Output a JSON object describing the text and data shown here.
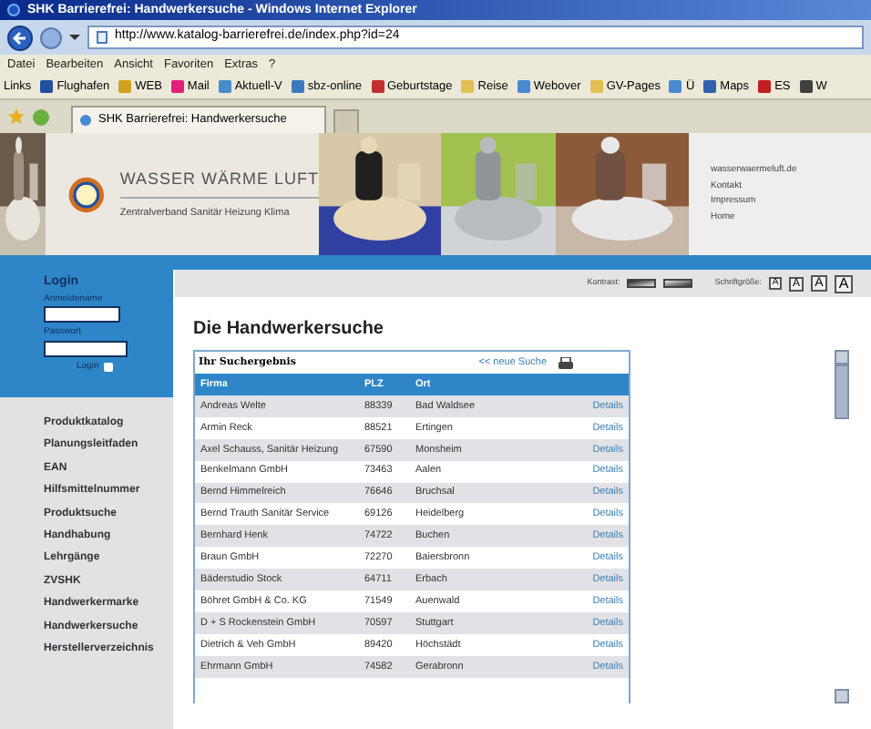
{
  "window": {
    "title": "SHK Barrierefrei: Handwerkersuche - Windows Internet Explorer"
  },
  "address_bar": {
    "value": "http://www.katalog-barrierefrei.de/index.php?id=24"
  },
  "menu": [
    "Datei",
    "Bearbeiten",
    "Ansicht",
    "Favoriten",
    "Extras",
    "?"
  ],
  "links_bar": {
    "label": "Links",
    "items": [
      {
        "label": "Flughafen",
        "color": "#2050a0"
      },
      {
        "label": "WEB",
        "color": "#d0a020"
      },
      {
        "label": "Mail",
        "color": "#e0207a"
      },
      {
        "label": "Aktuell-V",
        "color": "#4a8ad0"
      },
      {
        "label": "sbz-online",
        "color": "#3a7ac0"
      },
      {
        "label": "Geburtstage",
        "color": "#c03030"
      },
      {
        "label": "Reise",
        "color": "#e0c050"
      },
      {
        "label": "Webover",
        "color": "#4a8ad0"
      },
      {
        "label": "GV-Pages",
        "color": "#e0c050"
      },
      {
        "label": "Ü",
        "color": "#4a8ad0"
      },
      {
        "label": "Maps",
        "color": "#3060b0"
      },
      {
        "label": "ES",
        "color": "#c02020"
      },
      {
        "label": "W",
        "color": "#404040"
      }
    ]
  },
  "tabs": [
    {
      "label": "SHK Barrierefrei: Handwerkersuche",
      "selected": true
    }
  ],
  "banner": {
    "logo_title": "WASSER WÄRME LUFT",
    "logo_subtitle": "Zentralverband Sanitär Heizung Klima",
    "links": [
      "wasserwaermeluft.de",
      "Kontakt",
      "Impressum",
      "Home"
    ]
  },
  "login": {
    "title": "Login",
    "username_label": "Anmeldename",
    "password_label": "Passwort",
    "button": "Login"
  },
  "nav": [
    "Produktkatalog",
    "Planungsleitfaden",
    "EAN",
    "Hilfsmittelnummer",
    "Produktsuche",
    "Handhabung",
    "Lehrgänge",
    "ZVSHK",
    "Handwerkermarke",
    "Handwerkersuche",
    "Herstellerverzeichnis"
  ],
  "toolbar": {
    "contrast_label": "Kontrast:",
    "font_size_label": "Schriftgröße:",
    "font_sizes": [
      "A",
      "A",
      "A",
      "A"
    ]
  },
  "page_title": "Die Handwerkersuche",
  "results": {
    "title": "Ihr Suchergebnis",
    "new_search": "<< neue Suche",
    "columns": [
      "Firma",
      "PLZ",
      "Ort"
    ],
    "rows": [
      [
        "Andreas Welte",
        "88339",
        "Bad Waldsee",
        "Details"
      ],
      [
        "Armin Reck",
        "88521",
        "Ertingen",
        "Details"
      ],
      [
        "Axel Schauss, Sanitär Heizung",
        "67590",
        "Monsheim",
        "Details"
      ],
      [
        "Benkelmann GmbH",
        "73463",
        "Aalen",
        "Details"
      ],
      [
        "Bernd Himmelreich",
        "76646",
        "Bruchsal",
        "Details"
      ],
      [
        "Bernd Trauth Sanitär Service",
        "69126",
        "Heidelberg",
        "Details"
      ],
      [
        "Bernhard Henk",
        "74722",
        "Buchen",
        "Details"
      ],
      [
        "Braun GmbH",
        "72270",
        "Baiersbronn",
        "Details"
      ],
      [
        "Bäderstudio Stock",
        "64711",
        "Erbach",
        "Details"
      ],
      [
        "Böhret GmbH & Co. KG",
        "71549",
        "Auenwald",
        "Details"
      ],
      [
        "D + S Rockenstein GmbH",
        "70597",
        "Stuttgart",
        "Details"
      ],
      [
        "Dietrich & Veh GmbH",
        "89420",
        "Höchstädt",
        "Details"
      ],
      [
        "Ehrmann GmbH",
        "74582",
        "Gerabronn",
        "Details"
      ]
    ]
  }
}
